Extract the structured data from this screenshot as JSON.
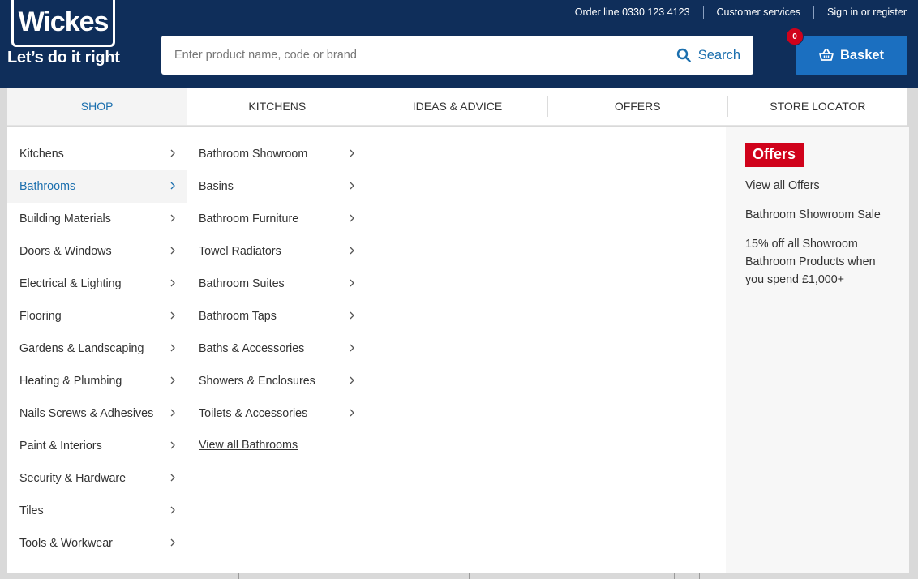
{
  "header": {
    "logo": "Wickes",
    "tagline": "Let’s do it right",
    "top_links": [
      "Order line 0330 123 4123",
      "Customer services",
      "Sign in or register"
    ],
    "search": {
      "placeholder": "Enter product name, code or brand",
      "value": "",
      "button_label": "Search"
    },
    "basket": {
      "label": "Basket",
      "count": "0"
    }
  },
  "nav": {
    "tabs": [
      {
        "label": "SHOP",
        "active": true
      },
      {
        "label": "KITCHENS",
        "active": false
      },
      {
        "label": "IDEAS & ADVICE",
        "active": false
      },
      {
        "label": "OFFERS",
        "active": false
      },
      {
        "label": "STORE LOCATOR",
        "active": false
      }
    ]
  },
  "menu": {
    "categories": [
      "Kitchens",
      "Bathrooms",
      "Building Materials",
      "Doors & Windows",
      "Electrical & Lighting",
      "Flooring",
      "Gardens & Landscaping",
      "Heating & Plumbing",
      "Nails Screws & Adhesives",
      "Paint & Interiors",
      "Security & Hardware",
      "Tiles",
      "Tools & Workwear"
    ],
    "active_category": "Bathrooms",
    "subcategories": [
      "Bathroom Showroom",
      "Basins",
      "Bathroom Furniture",
      "Towel Radiators",
      "Bathroom Suites",
      "Bathroom Taps",
      "Baths & Accessories",
      "Showers & Enclosures",
      "Toilets & Accessories"
    ],
    "view_all": "View all Bathrooms"
  },
  "offers": {
    "title": "Offers",
    "links": [
      "View all Offers",
      "Bathroom Showroom Sale"
    ],
    "promo": "15% off all Showroom Bathroom Products when you spend £1,000+"
  },
  "colors": {
    "header_bg": "#0f2e5a",
    "accent_blue": "#1b6fae",
    "basket_blue": "#1b6fc0",
    "offer_red": "#d0021b"
  }
}
